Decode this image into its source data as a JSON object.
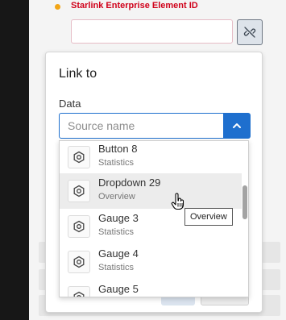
{
  "colors": {
    "accent": "#1e6fce",
    "required_dot": "#f2a516",
    "required_label": "#d0021b"
  },
  "field": {
    "label": "Starlink Enterprise Element ID",
    "value": "",
    "link_icon": "unlink-icon"
  },
  "panel": {
    "title": "Link to",
    "data_label": "Data",
    "source_placeholder": "Source name",
    "source_value": "",
    "toggle_icon": "chevron-up-icon"
  },
  "dropdown": {
    "item_icon": "widget-icon",
    "items": [
      {
        "name": "Button 8",
        "type": "Statistics"
      },
      {
        "name": "Dropdown 29",
        "type": "Overview"
      },
      {
        "name": "Gauge 3",
        "type": "Statistics"
      },
      {
        "name": "Gauge 4",
        "type": "Statistics"
      },
      {
        "name": "Gauge 5",
        "type": "Statistics"
      }
    ]
  },
  "tooltip": {
    "text": "Overview"
  }
}
